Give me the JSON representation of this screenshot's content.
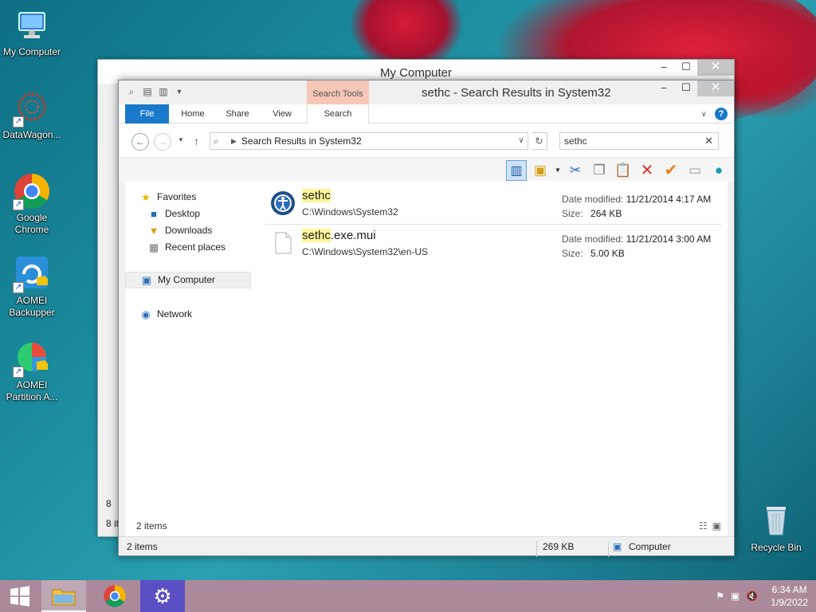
{
  "desktop": {
    "icons": [
      {
        "label": "My Computer",
        "icon": "computer-icon"
      },
      {
        "label": "DataWagon...",
        "icon": "datawagon-icon"
      },
      {
        "label": "Google Chrome",
        "icon": "chrome-icon"
      },
      {
        "label": "AOMEI Backupper",
        "icon": "aomei-backupper-icon"
      },
      {
        "label": "AOMEI Partition A...",
        "icon": "aomei-partition-icon"
      },
      {
        "label": "Recycle Bin",
        "icon": "recycle-bin-icon"
      }
    ]
  },
  "back_window": {
    "title": "My Computer",
    "status_items": "8 it",
    "left_fragment": "8"
  },
  "window": {
    "title": "sethc - Search Results in System32",
    "context_tab_group": "Search Tools",
    "ribbon_tabs": [
      "File",
      "Home",
      "Share",
      "View",
      "Search"
    ],
    "address": "Search Results in System32",
    "search_value": "sethc",
    "nav": {
      "favorites": "Favorites",
      "desktop": "Desktop",
      "downloads": "Downloads",
      "recent": "Recent places",
      "my_computer": "My Computer",
      "network": "Network"
    },
    "results": [
      {
        "name_highlight": "sethc",
        "name_rest": "",
        "path": "C:\\Windows\\System32",
        "date_label": "Date modified:",
        "date": "11/21/2014 4:17 AM",
        "size_label": "Size:",
        "size": "264 KB"
      },
      {
        "name_highlight": "sethc",
        "name_rest": ".exe.mui",
        "path": "C:\\Windows\\System32\\en-US",
        "date_label": "Date modified:",
        "date": "11/21/2014 3:00 AM",
        "size_label": "Size:",
        "size": "5.00 KB"
      }
    ],
    "item_count_inner": "2 items",
    "status": {
      "items": "2 items",
      "size": "269 KB",
      "location": "Computer"
    }
  },
  "taskbar": {
    "time": "6:34 AM",
    "date": "1/9/2022"
  },
  "colors": {
    "accent": "#1979ca",
    "highlight": "#fff59a",
    "context_tab": "#f6c6b6",
    "taskbar": "#ab8a9c"
  }
}
